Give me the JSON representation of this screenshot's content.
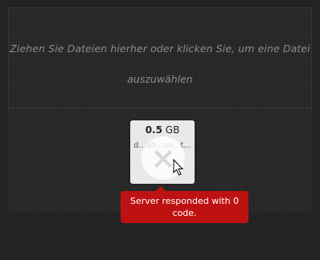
{
  "dropzone": {
    "message_line1": "Ziehen Sie Dateien hierher oder klicken Sie, um eine Datei",
    "message_line2": "auszuwählen"
  },
  "file": {
    "size_value": "0.5",
    "size_unit": "GB",
    "name": "d…ab…on…t…"
  },
  "error": {
    "message": "Server responded with 0 code.",
    "color": "#be1212"
  },
  "icons": {
    "error_mark": "error-x-icon",
    "cursor": "mouse-pointer-icon"
  }
}
